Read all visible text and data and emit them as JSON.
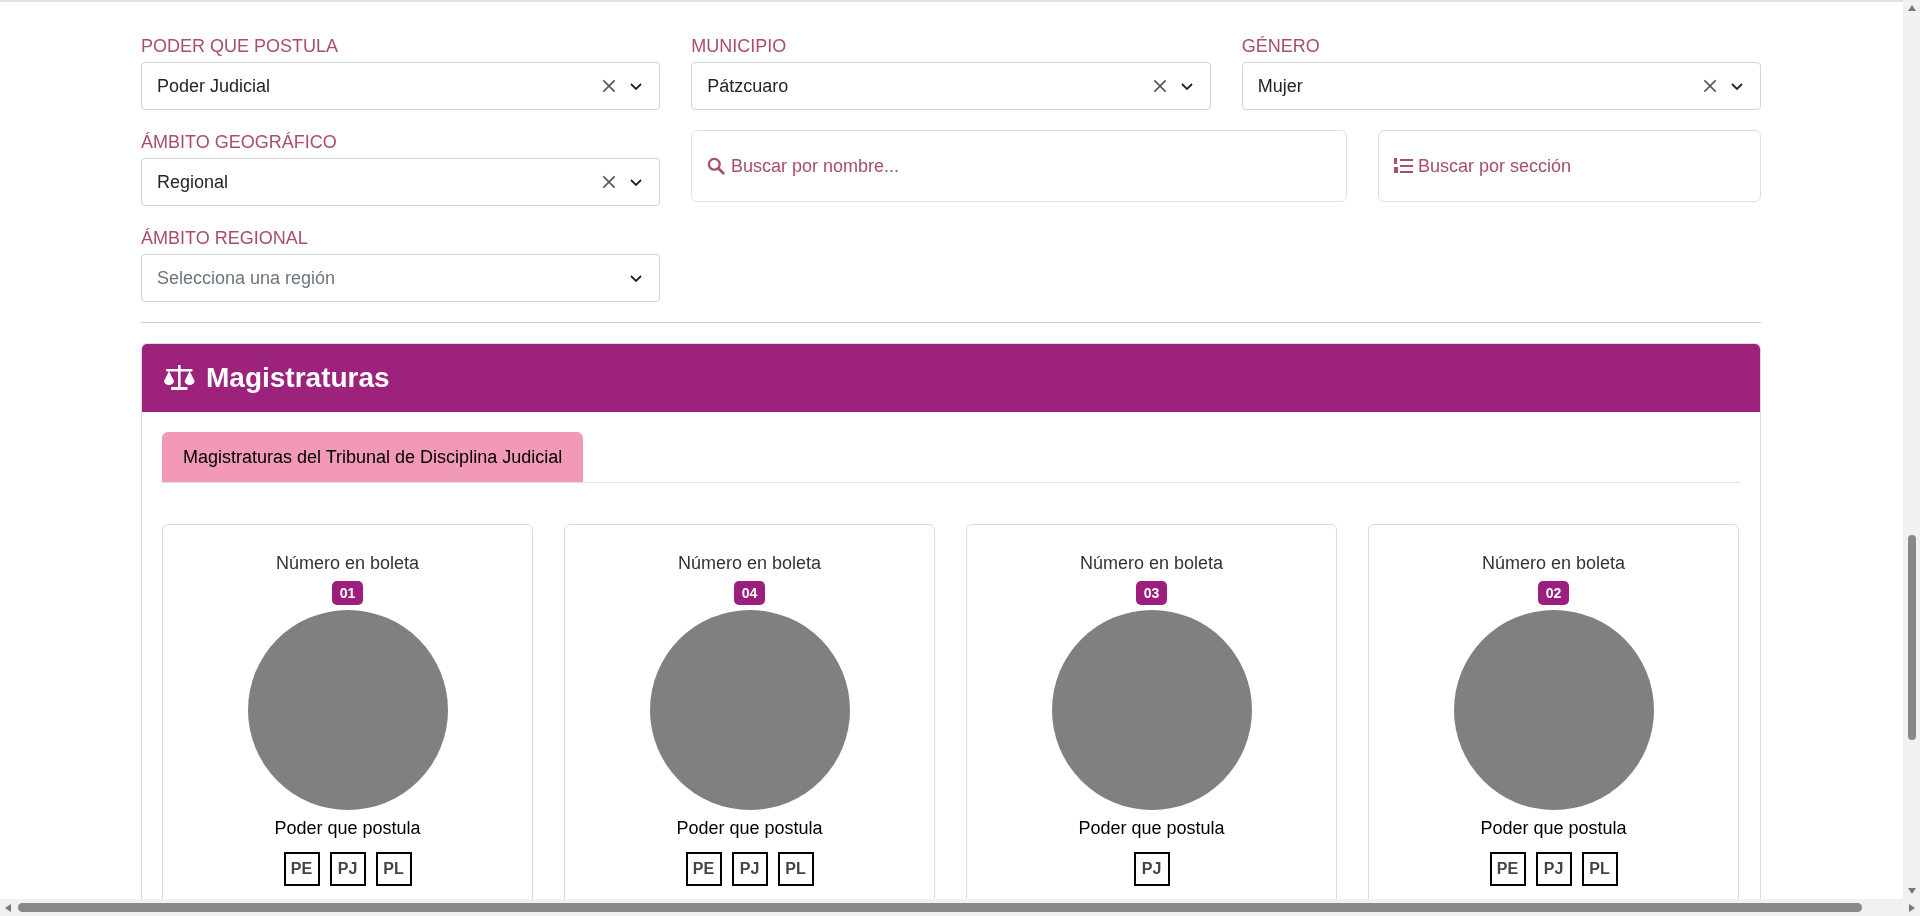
{
  "filters": [
    {
      "label": "PODER QUE POSTULA",
      "value": "Poder Judicial",
      "clearable": true
    },
    {
      "label": "MUNICIPIO",
      "value": "Pátzcuaro",
      "clearable": true
    },
    {
      "label": "GÉNERO",
      "value": "Mujer",
      "clearable": true
    },
    {
      "label": "ÁMBITO GEOGRÁFICO",
      "value": "Regional",
      "clearable": true
    },
    {
      "label": "ÁMBITO REGIONAL",
      "placeholder": "Selecciona una región",
      "clearable": false
    }
  ],
  "search_name": {
    "placeholder": "Buscar por nombre..."
  },
  "search_section": {
    "label": "Buscar por sección"
  },
  "panel": {
    "title": "Magistraturas",
    "tabs": [
      {
        "label": "Magistraturas del Tribunal de Disciplina Judicial",
        "selected": true
      }
    ],
    "cards": [
      {
        "number_label": "Número en boleta",
        "number": "01",
        "powers_label": "Poder que postula",
        "powers": [
          "PE",
          "PJ",
          "PL"
        ]
      },
      {
        "number_label": "Número en boleta",
        "number": "04",
        "powers_label": "Poder que postula",
        "powers": [
          "PE",
          "PJ",
          "PL"
        ]
      },
      {
        "number_label": "Número en boleta",
        "number": "03",
        "powers_label": "Poder que postula",
        "powers": [
          "PJ"
        ]
      },
      {
        "number_label": "Número en boleta",
        "number": "02",
        "powers_label": "Poder que postula",
        "powers": [
          "PE",
          "PJ",
          "PL"
        ]
      }
    ]
  }
}
